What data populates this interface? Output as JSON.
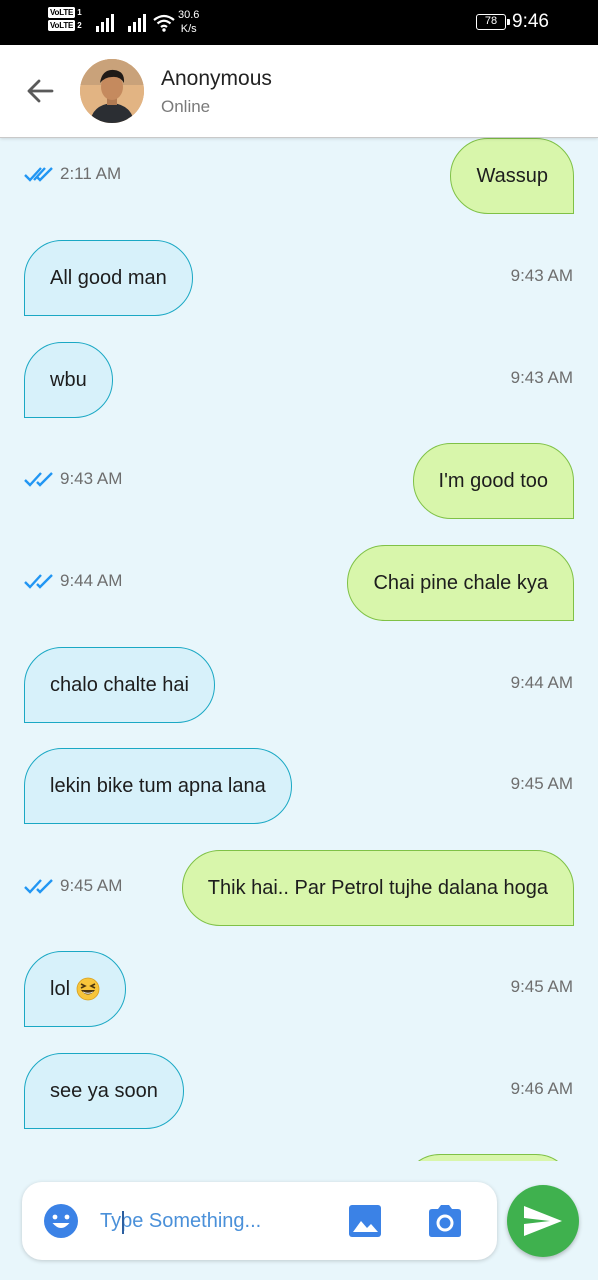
{
  "status_bar": {
    "volte_1": "VoLTE",
    "volte_1_sim": "1",
    "volte_2": "VoLTE",
    "volte_2_sim": "2",
    "speed_value": "30.6",
    "speed_unit": "K/s",
    "battery": "78",
    "time": "9:46"
  },
  "header": {
    "back_icon": "arrow-back-icon",
    "contact_name": "Anonymous",
    "contact_status": "Online"
  },
  "messages": [
    {
      "direction": "out",
      "text": "Wassup",
      "time": "2:11 AM"
    },
    {
      "direction": "in",
      "text": "All good man",
      "time": "9:43 AM"
    },
    {
      "direction": "in",
      "text": "wbu",
      "time": "9:43 AM"
    },
    {
      "direction": "out",
      "text": "I'm good too",
      "time": "9:43 AM"
    },
    {
      "direction": "out",
      "text": "Chai pine chale kya",
      "time": "9:44 AM"
    },
    {
      "direction": "in",
      "text": "chalo chalte hai",
      "time": "9:44 AM"
    },
    {
      "direction": "in",
      "text": "lekin bike tum apna lana",
      "time": "9:45 AM"
    },
    {
      "direction": "out",
      "text": "Thik hai.. Par Petrol tujhe dalana hoga",
      "time": "9:45 AM"
    },
    {
      "direction": "in",
      "text": "lol",
      "emoji": "grinning-squinting-face",
      "time": "9:45 AM"
    },
    {
      "direction": "in",
      "text": "see ya soon",
      "time": "9:46 AM"
    }
  ],
  "composer": {
    "placeholder": "Type Something...",
    "emoji_icon": "emoji-icon",
    "gallery_icon": "image-icon",
    "camera_icon": "camera-icon",
    "send_icon": "send-icon"
  },
  "colors": {
    "background": "#e8f6fb",
    "incoming_bubble": "#d7f1fa",
    "incoming_border": "#1aa8c4",
    "outgoing_bubble": "#d8f6ab",
    "outgoing_border": "#7fc146",
    "read_ticks": "#2196f3",
    "send_button": "#3fb14e",
    "icon_blue": "#3b82e6"
  }
}
